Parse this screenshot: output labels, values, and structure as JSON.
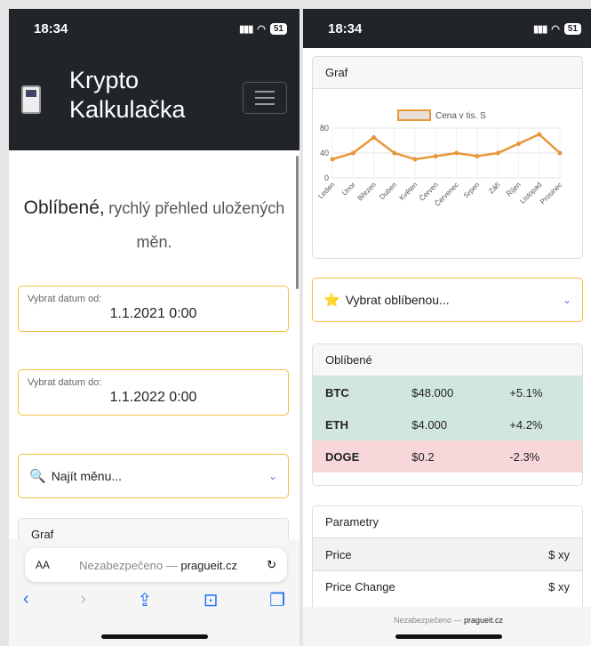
{
  "status": {
    "time": "18:34",
    "battery": "51"
  },
  "app": {
    "brand_line1": "Krypto",
    "brand_line2": "Kalkulačka"
  },
  "hero": {
    "title": "Oblíbené,",
    "subtitle": "rychlý přehled uložených měn."
  },
  "date_from": {
    "label": "Vybrat datum od:",
    "value": "1.1.2021 0:00"
  },
  "date_to": {
    "label": "Vybrat datum do:",
    "value": "1.1.2022 0:00"
  },
  "find_currency": {
    "label": "Najít měnu..."
  },
  "graph_card": {
    "title": "Graf"
  },
  "browser": {
    "aa": "AA",
    "insecure": "Nezabezpečeno —",
    "domain": "pragueit.cz"
  },
  "favorite_select": {
    "label": "Vybrat oblíbenou..."
  },
  "favorites": {
    "title": "Oblíbené",
    "rows": [
      {
        "symbol": "BTC",
        "price": "$48.000",
        "change": "+5.1%",
        "status": "up"
      },
      {
        "symbol": "ETH",
        "price": "$4.000",
        "change": "+4.2%",
        "status": "up"
      },
      {
        "symbol": "DOGE",
        "price": "$0.2",
        "change": "-2.3%",
        "status": "down"
      }
    ]
  },
  "params": {
    "title": "Parametry",
    "rows": [
      {
        "name": "Price",
        "value": "$ xy"
      },
      {
        "name": "Price Change",
        "value": "$ xy"
      }
    ]
  },
  "colors": {
    "accent": "#f0c040",
    "line": "#e8973a",
    "positive": "#d1e7dd",
    "negative": "#f8d7da",
    "dark": "#212529"
  },
  "chart_data": {
    "type": "line",
    "categories": [
      "Leden",
      "Únor",
      "Březen",
      "Duben",
      "Květen",
      "Červen",
      "Červenec",
      "Srpen",
      "Září",
      "Říjen",
      "Listopad",
      "Prosinec"
    ],
    "series": [
      {
        "name": "Cena v tis. S",
        "values": [
          30,
          40,
          65,
          40,
          30,
          35,
          40,
          35,
          40,
          55,
          70,
          40
        ]
      }
    ],
    "ylim": [
      0,
      80
    ],
    "yticks": [
      0,
      40,
      80
    ],
    "legend": "top"
  }
}
